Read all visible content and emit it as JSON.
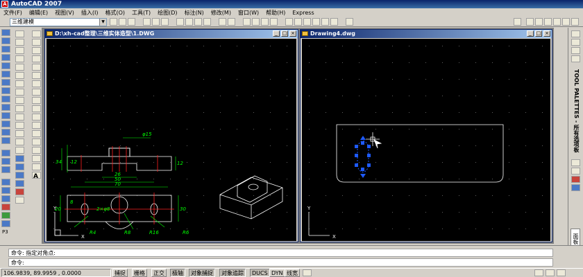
{
  "app": {
    "title": "AutoCAD 2007"
  },
  "menu": [
    "文件(F)",
    "编辑(E)",
    "视图(V)",
    "插入(I)",
    "格式(O)",
    "工具(T)",
    "绘图(D)",
    "标注(N)",
    "修改(M)",
    "窗口(W)",
    "帮助(H)",
    "Express"
  ],
  "toolbar": {
    "workspace": "三维建模"
  },
  "windows": {
    "left": {
      "title": "D:\\xh-cad整理\\三维实体造型\\1.DWG"
    },
    "right": {
      "title": "Drawing4.dwg"
    }
  },
  "left_drawing": {
    "dims": [
      "φ15",
      "34",
      "12",
      "12",
      "26",
      "50",
      "70",
      "20",
      "8",
      "30",
      "2×φ8",
      "R4",
      "R8",
      "R16",
      "R6"
    ],
    "axis_x": "X",
    "axis_y": "Y"
  },
  "right_drawing": {
    "axis_x": "X",
    "axis_y": "Y"
  },
  "command": {
    "history": "命令: 指定对角点:",
    "prompt": "命令:"
  },
  "status": {
    "coords": "106.9839, 89.9959 , 0.0000",
    "modes": [
      "捕捉",
      "栅格",
      "正交",
      "极轴",
      "对象捕捉",
      "对象追踪",
      "DUCS",
      "DYN",
      "线宽"
    ]
  },
  "palette": {
    "title": "TOOL PALETTES - 所有选项板",
    "tab": "面板"
  },
  "colors": {
    "dim_green": "#00ff00",
    "outline": "#ffffff",
    "grip_blue": "#1e5aff",
    "center_red": "#ff2020",
    "cursor_white": "#ffffff"
  }
}
